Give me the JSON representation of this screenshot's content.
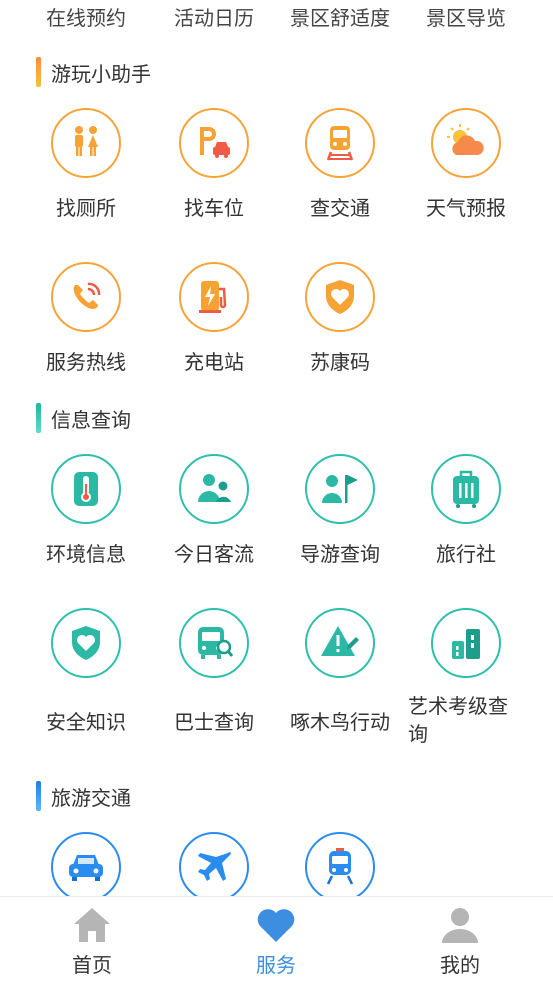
{
  "top_row": [
    "在线预约",
    "活动日历",
    "景区舒适度",
    "景区导览"
  ],
  "sections": {
    "assistant": {
      "title": "游玩小助手",
      "items": [
        "找厕所",
        "找车位",
        "查交通",
        "天气预报",
        "服务热线",
        "充电站",
        "苏康码"
      ]
    },
    "info": {
      "title": "信息查询",
      "items": [
        "环境信息",
        "今日客流",
        "导游查询",
        "旅行社",
        "安全知识",
        "巴士查询",
        "啄木鸟行动",
        "艺术考级查询"
      ]
    },
    "transport": {
      "title": "旅游交通",
      "items": [
        "出租车",
        "机场",
        "火车站"
      ]
    }
  },
  "tabbar": {
    "home": "首页",
    "service": "服务",
    "mine": "我的"
  },
  "colors": {
    "orange": "#f6a43a",
    "teal": "#2dbfab",
    "blue": "#2b8cf0",
    "active_tab": "#3d8de0",
    "inactive_tab": "#b5b5b5"
  }
}
